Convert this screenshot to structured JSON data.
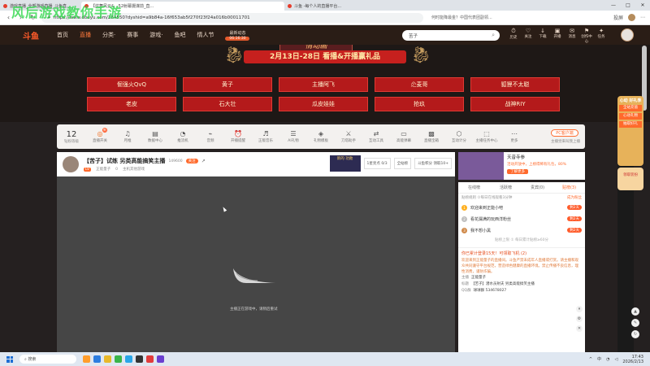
{
  "browser": {
    "tabs": [
      {
        "title": "游戏直播_全部游戏直播_斗鱼直..."
      },
      {
        "title": "【炫舞风云&...52射幕摄谋前_直..."
      },
      {
        "title": "斗鱼 -每个人的直播平台..."
      }
    ],
    "window_controls": [
      "—",
      "□",
      "✕"
    ],
    "url": "https://www.douyu.com/284550?dyshid=a9b84a-16f653ab5f270f23f24a016b00011701",
    "ad_tip": "何时能降最金？中国代表团副领...",
    "tool_labels": [
      "投屏",
      "⋯"
    ]
  },
  "watermark": "风后游戏教你手游",
  "site": {
    "logo": "斗鱼",
    "nav": [
      {
        "label": "首页",
        "active": false
      },
      {
        "label": "直播",
        "active": true
      },
      {
        "label": "分类·",
        "active": false
      },
      {
        "label": "赛事",
        "active": false
      },
      {
        "label": "游戏·",
        "active": false
      },
      {
        "label": "鱼吧",
        "active": false
      },
      {
        "label": "情人节",
        "active": false
      }
    ],
    "onair": {
      "title": "最新动态",
      "time": "06:16:30"
    },
    "search_value": "苦子",
    "header_icons": [
      {
        "glyph": "⏱",
        "label": "历史"
      },
      {
        "glyph": "♡",
        "label": "关注"
      },
      {
        "glyph": "↓",
        "label": "下载"
      },
      {
        "glyph": "▣",
        "label": "开播"
      },
      {
        "glyph": "✉",
        "label": "消息"
      },
      {
        "glyph": "⚑",
        "label": "创作中心"
      },
      {
        "glyph": "✦",
        "label": "任务"
      }
    ]
  },
  "banner": {
    "art_text": "情动画",
    "ribbon": "2月13日-28日 看播&开播赢礼品",
    "tags_row1": [
      "倔强火QvQ",
      "黄子",
      "主播阿飞",
      "尐麦哥",
      "狐狸不太聪"
    ],
    "tags_row2": [
      "老皮",
      "石大壮",
      "瓜皮娃娃",
      "抢玖",
      "战神RIY"
    ]
  },
  "toolbar": {
    "level": "12",
    "level_label": "钻粉等级",
    "items": [
      {
        "glyph": "◎",
        "label": "直播开关",
        "dot": "新"
      },
      {
        "glyph": "♫",
        "label": "月推",
        "dot": ""
      },
      {
        "glyph": "▤",
        "label": "数据中心",
        "dot": ""
      },
      {
        "glyph": "◔",
        "label": "推流机",
        "dot": ""
      },
      {
        "glyph": "⌁",
        "label": "音频",
        "dot": ""
      },
      {
        "glyph": "⏰",
        "label": "开播提醒",
        "dot": ""
      },
      {
        "glyph": "♬",
        "label": "正版音乐",
        "dot": ""
      },
      {
        "glyph": "☰",
        "label": "AI礼物",
        "dot": ""
      },
      {
        "glyph": "◈",
        "label": "礼物模板",
        "dot": ""
      },
      {
        "glyph": "⚔",
        "label": "刀塔助手",
        "dot": ""
      },
      {
        "glyph": "⇄",
        "label": "互动工具",
        "dot": ""
      },
      {
        "glyph": "▭",
        "label": "高能弹幕",
        "dot": ""
      },
      {
        "glyph": "▩",
        "label": "直播宝箱",
        "dot": ""
      },
      {
        "glyph": "⬡",
        "label": "互动计分",
        "dot": ""
      },
      {
        "glyph": "⬚",
        "label": "主播任务中心",
        "dot": ""
      },
      {
        "glyph": "⋯",
        "label": "更多",
        "dot": ""
      }
    ],
    "pc_button": "PC客户端",
    "pc_sub": "主播觉来叫我上播"
  },
  "stream": {
    "title": "【苦子】试练 另类高能搞笑主播",
    "fans": "149600",
    "follow": "关注",
    "level": "LV",
    "streamer": "正能量子",
    "heat": "0",
    "category": "主机其他游戏",
    "gift_label": "新的 功勋",
    "stat1_label": "1星亮点",
    "stat1_value": "0/3",
    "stat2_label": "全站榜",
    "stat3_label": "斗鱼积分",
    "stat3_value": "领取10+"
  },
  "player": {
    "status": "主播正在游戏中，请稍后重试"
  },
  "promo": {
    "title": "天音寺参",
    "desc": "活动开放中，上榜得稀有礼包，80%",
    "cta": "了解更多"
  },
  "rpanel": {
    "tabs": [
      {
        "label": "在线榜",
        "active": false
      },
      {
        "label": "活跃榜",
        "active": false
      },
      {
        "label": "贵宾(0)",
        "active": false
      },
      {
        "label": "贴榜(3)",
        "active": true
      }
    ],
    "note_left": "贴榜规则 ①每日在线观看3分钟",
    "note_right": "成为粉丝",
    "ranks": [
      {
        "no": "1",
        "name": "欢迎来到正能小吧",
        "badge": "剩2天"
      },
      {
        "no": "2",
        "name": "看花漏满的玩西洋粉丝",
        "badge": "剩2天"
      },
      {
        "no": "3",
        "name": "我不想小黑",
        "badge": "剩2天"
      }
    ],
    "rank_foot": "贴榜上限 ① 每日累计贴榜≥60分",
    "chat_head": "你已累计登录15天！可领取飞机 (2)",
    "chat_body": "欢迎来到正能量子的直播间。斗鱼严禁未成年人直播或打赏。请主播和观众共同遵守平台规范，营造绿色健康的直播环境。禁止传播不良信息，理性消费，谨防诈骗。",
    "chat_lines": [
      {
        "k": "主播",
        "v": "正能量子"
      },
      {
        "k": "标题",
        "v": "【苦子】潜水员射夫 另类高能搞笑主播"
      },
      {
        "k": "QQ群",
        "v": "球球群 534678027"
      }
    ]
  },
  "sidepromo": {
    "title": "心动 好礼季",
    "tags": [
      "全站充值",
      "心动礼物",
      "抽取好礼"
    ],
    "sp2": "领取装扮"
  },
  "taskbar": {
    "search": "搜索",
    "time": "17:43",
    "date": "2026/2/13",
    "lang": "中"
  }
}
